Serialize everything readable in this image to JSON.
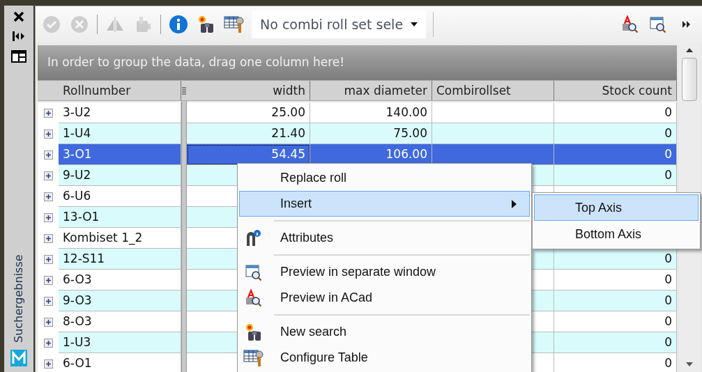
{
  "side_panel": {
    "label": "Suchergebnisse"
  },
  "toolbar": {
    "buttons": [
      {
        "disabled": true
      },
      {
        "disabled": true
      },
      {
        "disabled": true
      },
      {
        "disabled": true
      },
      {
        "disabled": false
      },
      {
        "disabled": false
      },
      {
        "disabled": false
      }
    ],
    "combo": {
      "value": "No combi roll set sele"
    },
    "right_buttons": [
      {
        "disabled": false
      },
      {
        "disabled": false
      },
      {
        "disabled": false
      }
    ]
  },
  "grid": {
    "group_hint": "In order to group the data, drag one column here!",
    "columns": [
      {
        "label": "Rollnumber"
      },
      {
        "label": "width"
      },
      {
        "label": "max diameter"
      },
      {
        "label": "Combirollset"
      },
      {
        "label": "Stock count"
      }
    ],
    "rows": [
      {
        "selected": false,
        "cells": [
          "3-U2",
          "25.00",
          "140.00",
          "",
          "0"
        ]
      },
      {
        "selected": false,
        "cells": [
          "1-U4",
          "21.40",
          "75.00",
          "",
          "0"
        ]
      },
      {
        "selected": true,
        "cells": [
          "3-O1",
          "54.45",
          "106.00",
          "",
          "0"
        ]
      },
      {
        "selected": false,
        "cells": [
          "9-U2",
          "",
          "",
          "",
          "0"
        ]
      },
      {
        "selected": false,
        "cells": [
          "6-U6",
          "",
          "",
          "",
          ""
        ]
      },
      {
        "selected": false,
        "cells": [
          "13-O1",
          "",
          "",
          "",
          ""
        ]
      },
      {
        "selected": false,
        "cells": [
          "Kombiset 1_2",
          "",
          "",
          "",
          ""
        ]
      },
      {
        "selected": false,
        "cells": [
          "12-S11",
          "",
          "",
          "",
          "0"
        ]
      },
      {
        "selected": false,
        "cells": [
          "6-O3",
          "",
          "",
          "",
          "0"
        ]
      },
      {
        "selected": false,
        "cells": [
          "9-O3",
          "",
          "",
          "",
          "0"
        ]
      },
      {
        "selected": false,
        "cells": [
          "8-O3",
          "",
          "",
          "",
          "0"
        ]
      },
      {
        "selected": false,
        "cells": [
          "1-U3",
          "",
          "",
          "",
          "0"
        ]
      },
      {
        "selected": false,
        "cells": [
          "6-O1",
          "",
          "",
          "",
          "0"
        ]
      }
    ]
  },
  "context_menu": {
    "items": [
      {
        "kind": "item",
        "label": "Replace roll",
        "highlighted": false
      },
      {
        "kind": "submenu",
        "label": "Insert",
        "highlighted": true
      },
      {
        "kind": "separator"
      },
      {
        "kind": "item",
        "label": "Attributes",
        "highlighted": false
      },
      {
        "kind": "separator"
      },
      {
        "kind": "item",
        "label": "Preview in separate window",
        "highlighted": false
      },
      {
        "kind": "item",
        "label": "Preview in ACad",
        "highlighted": false
      },
      {
        "kind": "separator"
      },
      {
        "kind": "item",
        "label": "New search",
        "highlighted": false
      },
      {
        "kind": "item",
        "label": "Configure Table",
        "highlighted": false
      }
    ],
    "submenu": [
      {
        "label": "Top Axis",
        "highlighted": true
      },
      {
        "label": "Bottom Axis",
        "highlighted": false
      }
    ]
  }
}
